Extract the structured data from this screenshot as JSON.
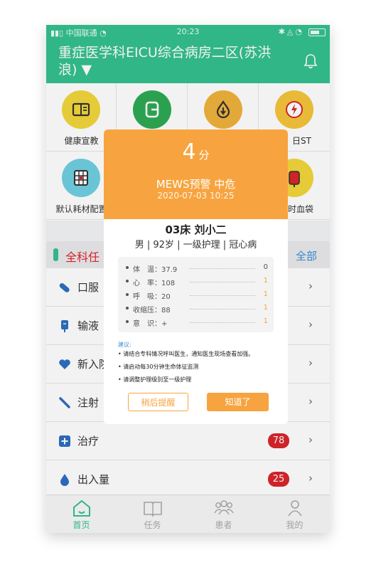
{
  "status_bar": {
    "carrier": "中国联通",
    "time": "20:23"
  },
  "header": {
    "title": "重症医学科EICU综合病房二区(苏洪浪) ▼"
  },
  "grid": {
    "items": [
      {
        "label": "健康宣教",
        "icon": "book-icon",
        "color": "#f2d63a"
      },
      {
        "label": "",
        "icon": "exit-icon",
        "color": "#2eaa55"
      },
      {
        "label": "",
        "icon": "drop-icon",
        "color": "#f0b33b"
      },
      {
        "label": "日ST",
        "icon": "bolt-icon",
        "color": "#f5c53a"
      },
      {
        "label": "默认耗材配置",
        "icon": "grid-icon",
        "color": "#6fd0e2"
      },
      {
        "label": "",
        "icon": "blank",
        "color": ""
      },
      {
        "label": "",
        "icon": "blank",
        "color": ""
      },
      {
        "label": "时血袋",
        "icon": "blood-bag-icon",
        "color": "#f2d63a"
      }
    ]
  },
  "task_section": {
    "title": "全科任",
    "all_label": "全部"
  },
  "task_list": [
    {
      "label": "口服",
      "icon": "pill-icon",
      "badge": ""
    },
    {
      "label": "输液",
      "icon": "infusion-icon",
      "badge": ""
    },
    {
      "label": "新入院",
      "icon": "heart-icon",
      "badge": ""
    },
    {
      "label": "注射",
      "icon": "syringe-icon",
      "badge": ""
    },
    {
      "label": "治疗",
      "icon": "plus-icon",
      "badge": "78"
    },
    {
      "label": "出入量",
      "icon": "drop-icon",
      "badge": "25"
    }
  ],
  "tabbar": [
    {
      "label": "首页",
      "icon": "home-icon",
      "active": true
    },
    {
      "label": "任务",
      "icon": "book-icon",
      "active": false
    },
    {
      "label": "患者",
      "icon": "group-icon",
      "active": false
    },
    {
      "label": "我的",
      "icon": "person-icon",
      "active": false
    }
  ],
  "modal": {
    "score": "4",
    "score_unit": "分",
    "level": "MEWS预警 中危",
    "datetime": "2020-07-03 10:25",
    "patient": "03床 刘小二",
    "patient_info": "男 | 92岁 | 一级护理 | 冠心病",
    "vitals": [
      {
        "label": "体　温：37.9",
        "score": "0"
      },
      {
        "label": "心　率：108",
        "score": "1"
      },
      {
        "label": "呼　吸：20",
        "score": "1"
      },
      {
        "label": "收缩压：88",
        "score": "1"
      },
      {
        "label": "意　识：+",
        "score": "1"
      }
    ],
    "advice_title": "建议:",
    "advice": [
      "• 请结合专科情况呼叫医生，通知医生现场查看加强。",
      "• 请启动每30分钟生命体征监测",
      "• 请调整护理级别至一级护理"
    ],
    "later_button": "稍后提醒",
    "ok_button": "知道了"
  },
  "colors": {
    "brand": "#34c08f",
    "warning": "#f7a440",
    "badge": "#d8252c",
    "link": "#3a8fd6"
  }
}
